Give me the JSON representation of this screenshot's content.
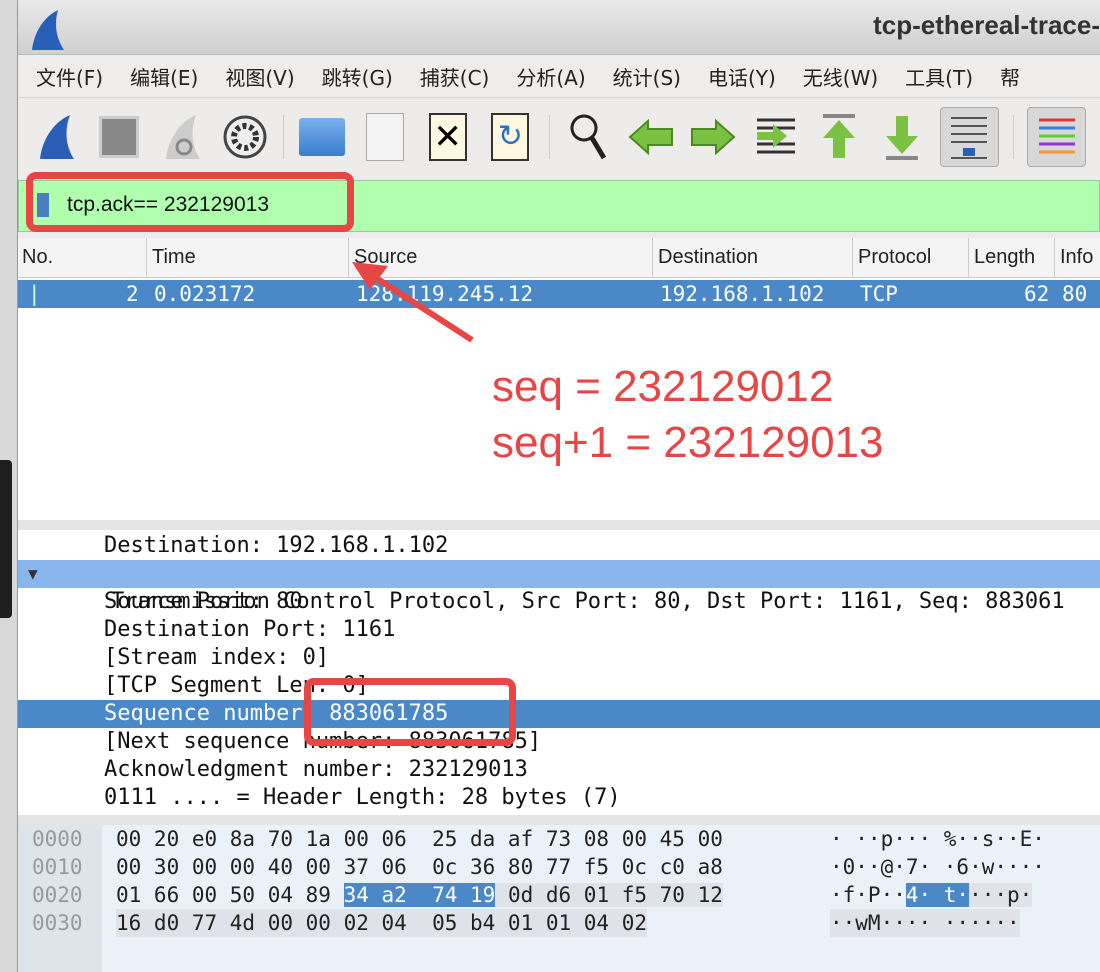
{
  "window": {
    "title": "tcp-ethereal-trace-"
  },
  "menu": [
    "文件(F)",
    "编辑(E)",
    "视图(V)",
    "跳转(G)",
    "捕获(C)",
    "分析(A)",
    "统计(S)",
    "电话(Y)",
    "无线(W)",
    "工具(T)",
    "帮"
  ],
  "toolbar": [
    "shark-fin-start-icon",
    "stop-icon",
    "restart-icon",
    "options-gear-icon",
    "open-folder-icon",
    "file-binary-icon",
    "close-file-icon",
    "reload-file-icon",
    "find-icon",
    "back-arrow-icon",
    "forward-arrow-icon",
    "go-to-packet-icon",
    "first-packet-icon",
    "last-packet-icon",
    "autoscroll-icon",
    "colorize-icon"
  ],
  "filter": {
    "value": "tcp.ack== 232129013"
  },
  "packet_list": {
    "columns": [
      "No.",
      "Time",
      "Source",
      "Destination",
      "Protocol",
      "Length",
      "Info"
    ],
    "rows": [
      {
        "no": "2",
        "time": "0.023172",
        "source": "128.119.245.12",
        "destination": "192.168.1.102",
        "protocol": "TCP",
        "length": "62",
        "info": "80"
      }
    ]
  },
  "annotation": {
    "line1": "seq = 232129012",
    "line2": "seq+1 = 232129013",
    "color": "#e84545"
  },
  "details": [
    "Destination: 192.168.1.102",
    "Transmission Control Protocol, Src Port: 80, Dst Port: 1161, Seq: 883061",
    "Source Port: 80",
    "Destination Port: 1161",
    "[Stream index: 0]",
    "[TCP Segment Len: 0]",
    "Sequence number: 883061785",
    "[Next sequence number: 883061785]",
    "Acknowledgment number: 232129013",
    "0111 .... = Header Length: 28 bytes (7)"
  ],
  "bytes": [
    {
      "offset": "0000",
      "hex": "00 20 e0 8a 70 1a 00 06  25 da af 73 08 00 45 00",
      "ascii": "· ··p··· %··s··E·"
    },
    {
      "offset": "0010",
      "hex": "00 30 00 00 40 00 37 06  0c 36 80 77 f5 0c c0 a8",
      "ascii": "·0··@·7· ·6·w····"
    },
    {
      "offset": "0020",
      "hex_pre": "01 66 00 50 04 89 ",
      "hex_sel": "34 a2  74 19",
      "hex_post": " 0d d6 01 f5 70 12",
      "ascii_pre": "·f·P··",
      "ascii_sel": "4· t·",
      "ascii_post": "···p·"
    },
    {
      "offset": "0030",
      "hex": "16 d0 77 4d 00 00 02 04  05 b4 01 01 04 02",
      "ascii": "··wM···· ······"
    }
  ]
}
